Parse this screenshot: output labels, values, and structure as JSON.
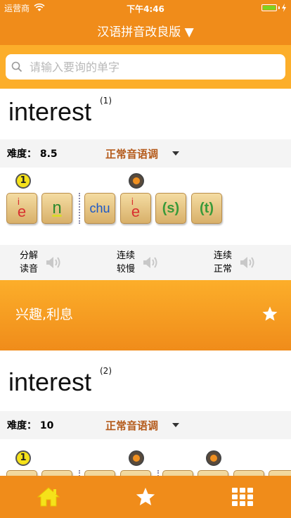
{
  "status_bar": {
    "carrier": "运营商",
    "time": "下午4:46"
  },
  "nav": {
    "title": "汉语拼音改良版 ▼"
  },
  "search": {
    "placeholder": "请输入要询的单字"
  },
  "entries": [
    {
      "word": "interest",
      "index": "(1)",
      "difficulty_label": "难度：",
      "difficulty_value": "8.5",
      "tone_mode": "正常音语调",
      "markers": [
        {
          "type": "number",
          "text": "1"
        },
        {
          "type": "dot"
        }
      ],
      "tiles": [
        {
          "text_top": "i",
          "text_main": "e",
          "style": "i"
        },
        {
          "text_main": "n",
          "style": "n"
        },
        {
          "text_main": "chu",
          "style": "chu"
        },
        {
          "text_top": "i",
          "text_main": "e",
          "style": "i"
        },
        {
          "text_main": "(s)",
          "style": "s"
        },
        {
          "text_main": "(t)",
          "style": "s"
        }
      ],
      "audio": [
        {
          "line1": "分解",
          "line2": "读音"
        },
        {
          "line1": "连续",
          "line2": "较慢"
        },
        {
          "line1": "连续",
          "line2": "正常"
        }
      ],
      "meaning": "兴趣,利息"
    },
    {
      "word": "interest",
      "index": "(2)",
      "difficulty_label": "难度：",
      "difficulty_value": "10",
      "tone_mode": "正常音语调",
      "markers": [
        {
          "type": "number",
          "text": "1"
        },
        {
          "type": "dot"
        },
        {
          "type": "dot"
        }
      ]
    }
  ],
  "tabs": [
    {
      "icon": "home-icon"
    },
    {
      "icon": "star-icon"
    },
    {
      "icon": "grid-icon"
    }
  ],
  "colors": {
    "primary": "#f08c1a",
    "accent": "#fcae2a",
    "tone": "#b45a1a"
  }
}
